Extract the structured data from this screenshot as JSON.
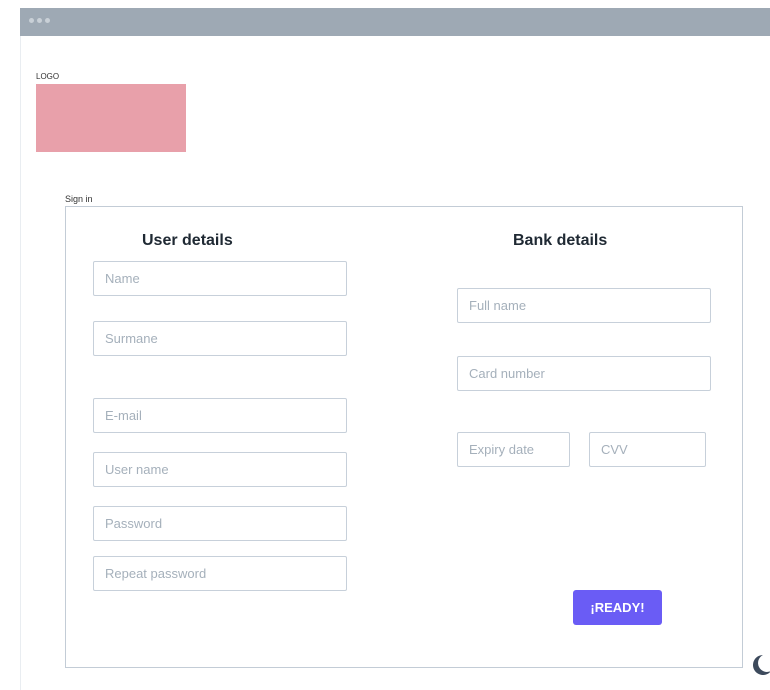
{
  "logo": {
    "label": "LOGO",
    "color": "#e8a0aa"
  },
  "sign_in": {
    "label": "Sign in"
  },
  "user_details": {
    "title": "User details",
    "fields": {
      "name": "Name",
      "surname": "Surmane",
      "email": "E-mail",
      "username": "User name",
      "password": "Password",
      "repeat_password": "Repeat password"
    }
  },
  "bank_details": {
    "title": "Bank details",
    "fields": {
      "full_name": "Full name",
      "card_number": "Card number",
      "expiry_date": "Expiry date",
      "cvv": "CVV"
    }
  },
  "submit": {
    "label": "¡READY!",
    "color": "#6a5cf5"
  },
  "icons": {
    "theme_toggle": "moon-icon"
  }
}
